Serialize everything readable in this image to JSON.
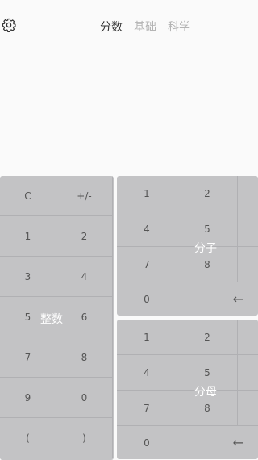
{
  "header": {
    "settings_icon": "gear-icon",
    "tabs": [
      {
        "label": "分数",
        "active": true
      },
      {
        "label": "基础",
        "active": false
      },
      {
        "label": "科学",
        "active": false
      }
    ]
  },
  "integer_pad": {
    "label": "整数",
    "keys": [
      "C",
      "+/-",
      "1",
      "2",
      "3",
      "4",
      "5",
      "6",
      "7",
      "8",
      "9",
      "0",
      "(",
      ")"
    ]
  },
  "numerator_pad": {
    "label": "分子",
    "keys": [
      "1",
      "2",
      "4",
      "5",
      "7",
      "8",
      "0"
    ],
    "backspace": "←"
  },
  "denominator_pad": {
    "label": "分母",
    "keys": [
      "1",
      "2",
      "4",
      "5",
      "7",
      "8",
      "0"
    ],
    "backspace": "←"
  },
  "colors": {
    "background": "#fafafa",
    "keypad": "#c3c3c5",
    "active_tab": "#333333",
    "inactive_tab": "#b4b4b4"
  }
}
